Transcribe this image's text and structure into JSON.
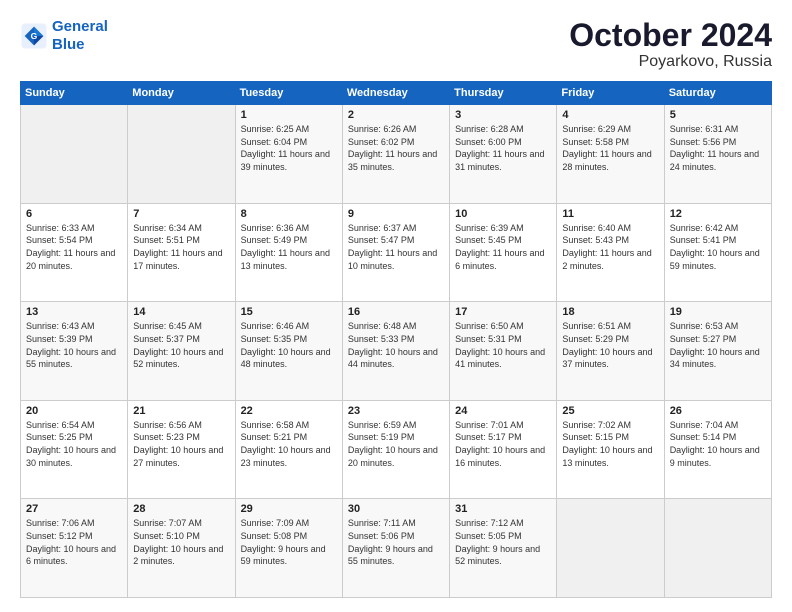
{
  "logo": {
    "line1": "General",
    "line2": "Blue"
  },
  "title": "October 2024",
  "subtitle": "Poyarkovo, Russia",
  "days_of_week": [
    "Sunday",
    "Monday",
    "Tuesday",
    "Wednesday",
    "Thursday",
    "Friday",
    "Saturday"
  ],
  "weeks": [
    [
      {
        "num": "",
        "text": ""
      },
      {
        "num": "",
        "text": ""
      },
      {
        "num": "1",
        "text": "Sunrise: 6:25 AM\nSunset: 6:04 PM\nDaylight: 11 hours and 39 minutes."
      },
      {
        "num": "2",
        "text": "Sunrise: 6:26 AM\nSunset: 6:02 PM\nDaylight: 11 hours and 35 minutes."
      },
      {
        "num": "3",
        "text": "Sunrise: 6:28 AM\nSunset: 6:00 PM\nDaylight: 11 hours and 31 minutes."
      },
      {
        "num": "4",
        "text": "Sunrise: 6:29 AM\nSunset: 5:58 PM\nDaylight: 11 hours and 28 minutes."
      },
      {
        "num": "5",
        "text": "Sunrise: 6:31 AM\nSunset: 5:56 PM\nDaylight: 11 hours and 24 minutes."
      }
    ],
    [
      {
        "num": "6",
        "text": "Sunrise: 6:33 AM\nSunset: 5:54 PM\nDaylight: 11 hours and 20 minutes."
      },
      {
        "num": "7",
        "text": "Sunrise: 6:34 AM\nSunset: 5:51 PM\nDaylight: 11 hours and 17 minutes."
      },
      {
        "num": "8",
        "text": "Sunrise: 6:36 AM\nSunset: 5:49 PM\nDaylight: 11 hours and 13 minutes."
      },
      {
        "num": "9",
        "text": "Sunrise: 6:37 AM\nSunset: 5:47 PM\nDaylight: 11 hours and 10 minutes."
      },
      {
        "num": "10",
        "text": "Sunrise: 6:39 AM\nSunset: 5:45 PM\nDaylight: 11 hours and 6 minutes."
      },
      {
        "num": "11",
        "text": "Sunrise: 6:40 AM\nSunset: 5:43 PM\nDaylight: 11 hours and 2 minutes."
      },
      {
        "num": "12",
        "text": "Sunrise: 6:42 AM\nSunset: 5:41 PM\nDaylight: 10 hours and 59 minutes."
      }
    ],
    [
      {
        "num": "13",
        "text": "Sunrise: 6:43 AM\nSunset: 5:39 PM\nDaylight: 10 hours and 55 minutes."
      },
      {
        "num": "14",
        "text": "Sunrise: 6:45 AM\nSunset: 5:37 PM\nDaylight: 10 hours and 52 minutes."
      },
      {
        "num": "15",
        "text": "Sunrise: 6:46 AM\nSunset: 5:35 PM\nDaylight: 10 hours and 48 minutes."
      },
      {
        "num": "16",
        "text": "Sunrise: 6:48 AM\nSunset: 5:33 PM\nDaylight: 10 hours and 44 minutes."
      },
      {
        "num": "17",
        "text": "Sunrise: 6:50 AM\nSunset: 5:31 PM\nDaylight: 10 hours and 41 minutes."
      },
      {
        "num": "18",
        "text": "Sunrise: 6:51 AM\nSunset: 5:29 PM\nDaylight: 10 hours and 37 minutes."
      },
      {
        "num": "19",
        "text": "Sunrise: 6:53 AM\nSunset: 5:27 PM\nDaylight: 10 hours and 34 minutes."
      }
    ],
    [
      {
        "num": "20",
        "text": "Sunrise: 6:54 AM\nSunset: 5:25 PM\nDaylight: 10 hours and 30 minutes."
      },
      {
        "num": "21",
        "text": "Sunrise: 6:56 AM\nSunset: 5:23 PM\nDaylight: 10 hours and 27 minutes."
      },
      {
        "num": "22",
        "text": "Sunrise: 6:58 AM\nSunset: 5:21 PM\nDaylight: 10 hours and 23 minutes."
      },
      {
        "num": "23",
        "text": "Sunrise: 6:59 AM\nSunset: 5:19 PM\nDaylight: 10 hours and 20 minutes."
      },
      {
        "num": "24",
        "text": "Sunrise: 7:01 AM\nSunset: 5:17 PM\nDaylight: 10 hours and 16 minutes."
      },
      {
        "num": "25",
        "text": "Sunrise: 7:02 AM\nSunset: 5:15 PM\nDaylight: 10 hours and 13 minutes."
      },
      {
        "num": "26",
        "text": "Sunrise: 7:04 AM\nSunset: 5:14 PM\nDaylight: 10 hours and 9 minutes."
      }
    ],
    [
      {
        "num": "27",
        "text": "Sunrise: 7:06 AM\nSunset: 5:12 PM\nDaylight: 10 hours and 6 minutes."
      },
      {
        "num": "28",
        "text": "Sunrise: 7:07 AM\nSunset: 5:10 PM\nDaylight: 10 hours and 2 minutes."
      },
      {
        "num": "29",
        "text": "Sunrise: 7:09 AM\nSunset: 5:08 PM\nDaylight: 9 hours and 59 minutes."
      },
      {
        "num": "30",
        "text": "Sunrise: 7:11 AM\nSunset: 5:06 PM\nDaylight: 9 hours and 55 minutes."
      },
      {
        "num": "31",
        "text": "Sunrise: 7:12 AM\nSunset: 5:05 PM\nDaylight: 9 hours and 52 minutes."
      },
      {
        "num": "",
        "text": ""
      },
      {
        "num": "",
        "text": ""
      }
    ]
  ]
}
